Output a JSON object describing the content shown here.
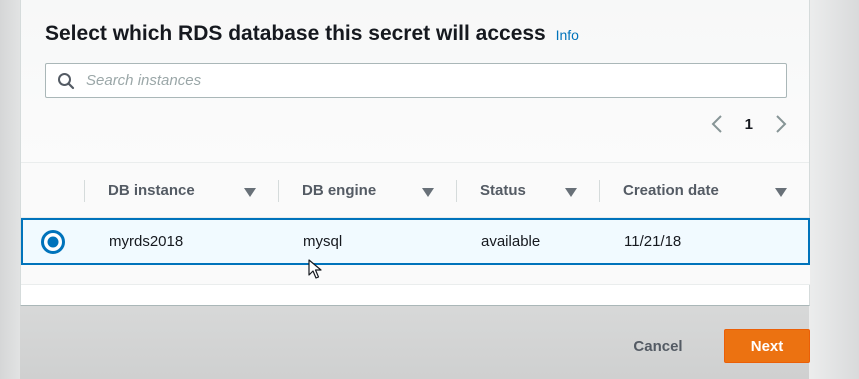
{
  "dialog": {
    "title": "Select which RDS database this secret will access",
    "info_link": "Info"
  },
  "search": {
    "placeholder": "Search instances",
    "value": ""
  },
  "pagination": {
    "current_page": "1"
  },
  "table": {
    "columns": [
      "DB instance",
      "DB engine",
      "Status",
      "Creation date"
    ],
    "rows": [
      {
        "selected": true,
        "db_instance": "myrds2018",
        "db_engine": "mysql",
        "status": "available",
        "creation_date": "11/21/18"
      }
    ]
  },
  "footer": {
    "cancel_label": "Cancel",
    "next_label": "Next"
  },
  "colors": {
    "accent": "#0073bb",
    "primary_button": "#ec7211",
    "selected_row_bg": "#f1faff"
  },
  "icons": {
    "search": "search-icon",
    "prev": "chevron-left-icon",
    "next": "chevron-right-icon",
    "sort": "caret-down-icon",
    "radio": "radio-selected-icon",
    "cursor": "mouse-cursor-icon"
  }
}
